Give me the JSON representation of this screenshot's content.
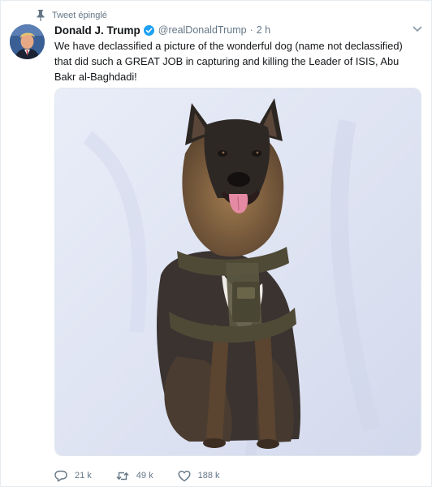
{
  "tweet": {
    "pinned_label": "Tweet épinglé",
    "display_name": "Donald J. Trump",
    "handle": "@realDonaldTrump",
    "separator": "·",
    "timestamp": "2 h",
    "text": "We have declassified a picture of the wonderful dog (name not declassified) that did such a GREAT JOB in capturing and killing the Leader of ISIS, Abu Bakr al-Baghdadi!",
    "actions": {
      "reply_count": "21 k",
      "retweet_count": "49 k",
      "like_count": "188 k"
    }
  },
  "icons": {
    "pin": "pin-icon",
    "verified": "verified-badge-icon",
    "more": "chevron-down-icon",
    "reply": "reply-icon",
    "retweet": "retweet-icon",
    "like": "heart-icon"
  },
  "colors": {
    "verified_blue": "#1da1f2",
    "muted_text": "#657786",
    "primary_text": "#14171a"
  }
}
